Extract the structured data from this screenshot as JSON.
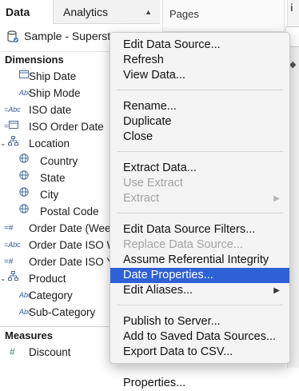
{
  "tabs": {
    "data_label": "Data",
    "analytics_label": "Analytics"
  },
  "data_source": {
    "name": "Sample - Superstore"
  },
  "sections": {
    "dimensions": "Dimensions",
    "measures": "Measures"
  },
  "dimensions": [
    {
      "icon": "calendar",
      "name": "Ship Date"
    },
    {
      "icon": "Abc",
      "name": "Ship Mode"
    },
    {
      "icon": "=Abc",
      "name": "ISO date"
    },
    {
      "icon": "=calendar",
      "name": "ISO Order Date"
    },
    {
      "icon": "hierarchy",
      "name": "Location"
    },
    {
      "icon": "globe",
      "name": "Country"
    },
    {
      "icon": "globe",
      "name": "State"
    },
    {
      "icon": "globe",
      "name": "City"
    },
    {
      "icon": "globe",
      "name": "Postal Code"
    },
    {
      "icon": "=#",
      "name": "Order Date (Week ("
    },
    {
      "icon": "=Abc",
      "name": "Order Date ISO We"
    },
    {
      "icon": "=#",
      "name": "Order Date ISO Yea"
    },
    {
      "icon": "hierarchy",
      "name": "Product"
    },
    {
      "icon": "Abc",
      "name": "Category"
    },
    {
      "icon": "Abc",
      "name": "Sub-Category"
    }
  ],
  "measures": [
    {
      "icon": "#",
      "name": "Discount"
    }
  ],
  "pages_shelf": {
    "label": "Pages"
  },
  "menu": {
    "groups": [
      [
        {
          "label": "Edit Data Source...",
          "enabled": true
        },
        {
          "label": "Refresh",
          "enabled": true
        },
        {
          "label": "View Data...",
          "enabled": true
        }
      ],
      [
        {
          "label": "Rename...",
          "enabled": true
        },
        {
          "label": "Duplicate",
          "enabled": true
        },
        {
          "label": "Close",
          "enabled": true
        }
      ],
      [
        {
          "label": "Extract Data...",
          "enabled": true
        },
        {
          "label": "Use Extract",
          "enabled": false
        },
        {
          "label": "Extract",
          "enabled": false,
          "submenu": true
        }
      ],
      [
        {
          "label": "Edit Data Source Filters...",
          "enabled": true
        },
        {
          "label": "Replace Data Source...",
          "enabled": false
        },
        {
          "label": "Assume Referential Integrity",
          "enabled": true
        },
        {
          "label": "Date Properties...",
          "enabled": true,
          "highlighted": true
        },
        {
          "label": "Edit Aliases...",
          "enabled": true,
          "submenu": true
        }
      ],
      [
        {
          "label": "Publish to Server...",
          "enabled": true
        },
        {
          "label": "Add to Saved Data Sources...",
          "enabled": true
        },
        {
          "label": "Export Data to CSV...",
          "enabled": true
        }
      ],
      [
        {
          "label": "Properties...",
          "enabled": true
        }
      ]
    ]
  },
  "colors": {
    "highlight": "#2f61d6",
    "disabled_text": "#a3a3a3",
    "field_icon": "#4a6fa5"
  }
}
